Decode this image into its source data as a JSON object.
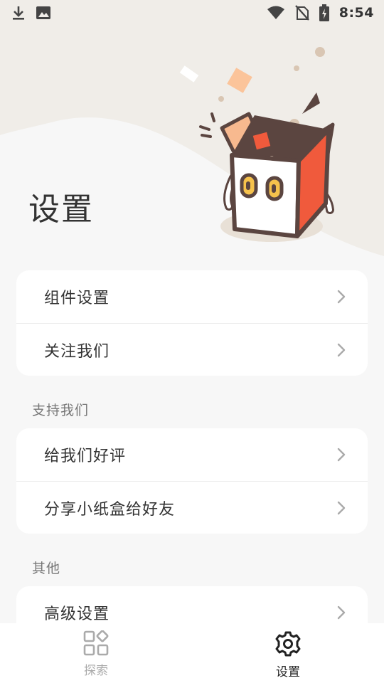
{
  "status_bar": {
    "time": "8:54",
    "left_icons": [
      "download-icon",
      "image-icon"
    ],
    "right_icons": [
      "wifi-icon",
      "no-sim-icon",
      "battery-charging-icon"
    ]
  },
  "page": {
    "title": "设置"
  },
  "groups": [
    {
      "header": "",
      "items": [
        {
          "label": "组件设置"
        },
        {
          "label": "关注我们"
        }
      ]
    },
    {
      "header": "支持我们",
      "items": [
        {
          "label": "给我们好评"
        },
        {
          "label": "分享小纸盒给好友"
        }
      ]
    },
    {
      "header": "其他",
      "items": [
        {
          "label": "高级设置"
        }
      ]
    }
  ],
  "bottom_nav": {
    "tabs": [
      {
        "label": "探索",
        "icon": "grid-icon",
        "active": false
      },
      {
        "label": "设置",
        "icon": "gear-icon",
        "active": true
      }
    ]
  },
  "colors": {
    "hero_background": "#f0ede8",
    "page_background": "#f7f7f7",
    "box_accent": "#f05a3c",
    "box_outline": "#5b4540"
  }
}
